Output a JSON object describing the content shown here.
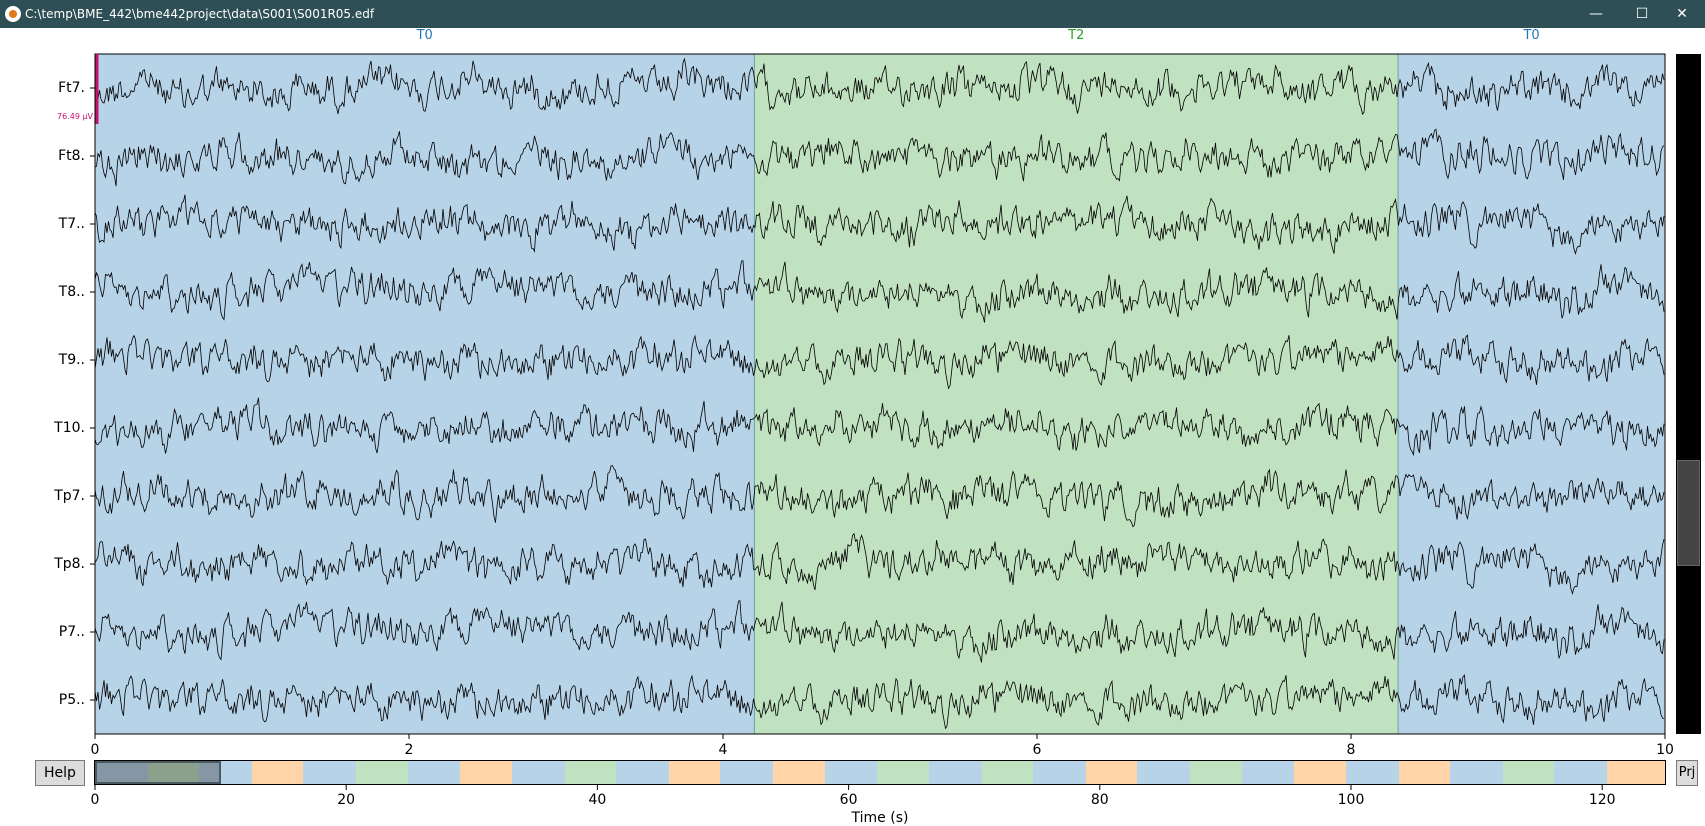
{
  "window": {
    "title": "C:\\temp\\BME_442\\bme442project\\data\\S001\\S001R05.edf",
    "minimize_icon": "minimize-icon",
    "maximize_icon": "maximize-icon",
    "close_icon": "close-icon"
  },
  "annotations": [
    {
      "label": "T0",
      "start": 0,
      "end": 4.2,
      "color": "#b7d3e8",
      "label_color": "#1f77b4"
    },
    {
      "label": "T2",
      "start": 4.2,
      "end": 8.3,
      "color": "#c0e2c0",
      "label_color": "#2ca02c"
    },
    {
      "label": "T0",
      "start": 8.3,
      "end": 10,
      "color": "#b7d3e8",
      "label_color": "#1f77b4"
    }
  ],
  "channels": [
    "Ft7.",
    "Ft8.",
    "T7..",
    "T8..",
    "T9..",
    "T10.",
    "Tp7.",
    "Tp8.",
    "P7..",
    "P5.."
  ],
  "scale_bar": {
    "label": "76.49 µV",
    "color": "#c0136b"
  },
  "time_axis": {
    "ticks": [
      "0",
      "2",
      "4",
      "6",
      "8",
      "10"
    ],
    "min": 0,
    "max": 10
  },
  "overview": {
    "ticks": [
      "0",
      "20",
      "40",
      "60",
      "80",
      "100",
      "120"
    ],
    "min": 0,
    "max": 125,
    "view_window": [
      0,
      10
    ],
    "label": "Time (s)",
    "segments": [
      {
        "t0": 0,
        "t1": 4.2,
        "color": "#b7d3e8"
      },
      {
        "t0": 4.2,
        "t1": 8.3,
        "color": "#c0e2c0"
      },
      {
        "t0": 8.3,
        "t1": 12.5,
        "color": "#b7d3e8"
      },
      {
        "t0": 12.5,
        "t1": 16.6,
        "color": "#fed4a8"
      },
      {
        "t0": 16.6,
        "t1": 20.8,
        "color": "#b7d3e8"
      },
      {
        "t0": 20.8,
        "t1": 24.9,
        "color": "#c0e2c0"
      },
      {
        "t0": 24.9,
        "t1": 29.1,
        "color": "#b7d3e8"
      },
      {
        "t0": 29.1,
        "t1": 33.2,
        "color": "#fed4a8"
      },
      {
        "t0": 33.2,
        "t1": 37.4,
        "color": "#b7d3e8"
      },
      {
        "t0": 37.4,
        "t1": 41.5,
        "color": "#c0e2c0"
      },
      {
        "t0": 41.5,
        "t1": 45.7,
        "color": "#b7d3e8"
      },
      {
        "t0": 45.7,
        "t1": 49.8,
        "color": "#fed4a8"
      },
      {
        "t0": 49.8,
        "t1": 54.0,
        "color": "#b7d3e8"
      },
      {
        "t0": 54.0,
        "t1": 58.1,
        "color": "#fed4a8"
      },
      {
        "t0": 58.1,
        "t1": 62.3,
        "color": "#b7d3e8"
      },
      {
        "t0": 62.3,
        "t1": 66.4,
        "color": "#c0e2c0"
      },
      {
        "t0": 66.4,
        "t1": 70.6,
        "color": "#b7d3e8"
      },
      {
        "t0": 70.6,
        "t1": 74.7,
        "color": "#c0e2c0"
      },
      {
        "t0": 74.7,
        "t1": 78.9,
        "color": "#b7d3e8"
      },
      {
        "t0": 78.9,
        "t1": 83.0,
        "color": "#fed4a8"
      },
      {
        "t0": 83.0,
        "t1": 87.2,
        "color": "#b7d3e8"
      },
      {
        "t0": 87.2,
        "t1": 91.3,
        "color": "#c0e2c0"
      },
      {
        "t0": 91.3,
        "t1": 95.5,
        "color": "#b7d3e8"
      },
      {
        "t0": 95.5,
        "t1": 99.6,
        "color": "#fed4a8"
      },
      {
        "t0": 99.6,
        "t1": 103.8,
        "color": "#b7d3e8"
      },
      {
        "t0": 103.8,
        "t1": 107.9,
        "color": "#fed4a8"
      },
      {
        "t0": 107.9,
        "t1": 112.1,
        "color": "#b7d3e8"
      },
      {
        "t0": 112.1,
        "t1": 116.2,
        "color": "#c0e2c0"
      },
      {
        "t0": 116.2,
        "t1": 120.4,
        "color": "#b7d3e8"
      },
      {
        "t0": 120.4,
        "t1": 125,
        "color": "#fed4a8"
      }
    ]
  },
  "buttons": {
    "help": "Help",
    "prj": "Prj"
  }
}
